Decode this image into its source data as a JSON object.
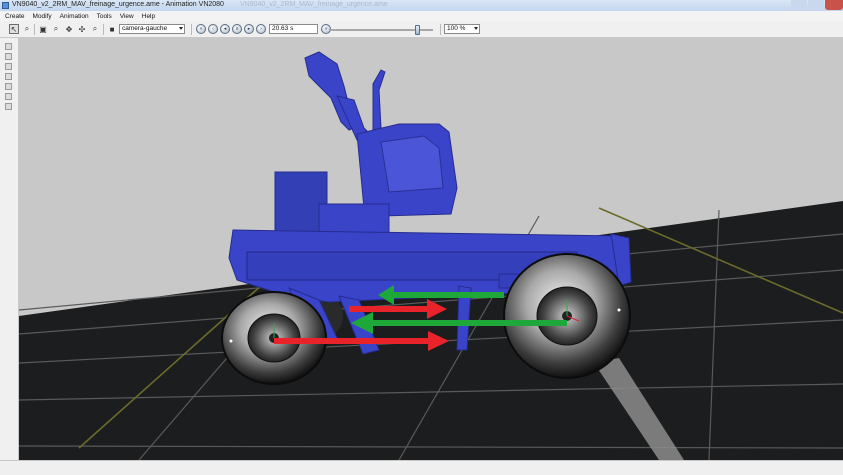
{
  "window": {
    "title": "VN9040_v2_2RM_MAV_freinage_urgence.ame - Animation VN2080",
    "ghost_title": "VN9040_v2_2RM_MAV_freinage_urgence.ame"
  },
  "menu": {
    "items": [
      {
        "label": "Create"
      },
      {
        "label": "Modify"
      },
      {
        "label": "Animation"
      },
      {
        "label": "Tools"
      },
      {
        "label": "View"
      },
      {
        "label": "Help"
      }
    ]
  },
  "toolbar": {
    "camera_select": {
      "value": "camera-gauche"
    },
    "time_value": "20.63 s",
    "zoom_select": {
      "value": "100 %"
    },
    "timeline_progress": 0.85,
    "playback_icons": [
      "first-frame-icon",
      "step-back-icon",
      "play-backward-icon",
      "pause-icon",
      "play-icon",
      "step-forward-icon",
      "last-frame-icon"
    ],
    "tool_icons": [
      "select-icon",
      "zoom-region-icon",
      "fit-view-icon",
      "magnify-icon",
      "pan-icon",
      "rotate-icon",
      "zoom-icon",
      "camera-icon"
    ]
  },
  "colors": {
    "vehicle_body": "#3a44c8",
    "arrow_red": "#e8242a",
    "arrow_green": "#1fa83a",
    "ground": "#1c1d1e",
    "grid_line": "#5a5a5a",
    "axis_line": "#6b6b2a",
    "sky": "#c8c8c8"
  },
  "side_panel_icons": [
    "view-front-icon",
    "view-back-icon",
    "view-left-icon",
    "view-right-icon",
    "view-top-icon",
    "view-bottom-icon",
    "view-iso-icon"
  ]
}
